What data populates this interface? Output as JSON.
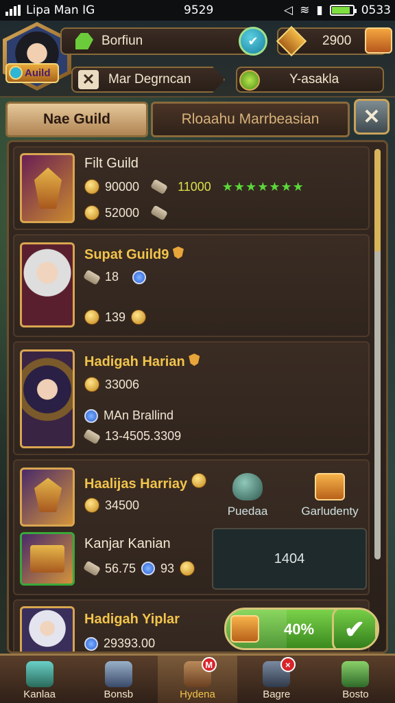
{
  "status_bar": {
    "carrier": "Lipa Man IG",
    "time": "9529",
    "clock": "0533",
    "battery_level": 0.85
  },
  "header": {
    "guild_tag": "Auild",
    "player_name": "Borfiun",
    "gold": "2900",
    "sub_label": "Mar Degrncan",
    "sub_label_right": "Y-asakla"
  },
  "tabs": [
    {
      "label": "Nae Guild",
      "active": true
    },
    {
      "label": "Rloaahu Marrbeasian",
      "active": false
    }
  ],
  "cards": [
    {
      "title": "Filt Guild",
      "row1_value": "90000",
      "row1_extra": "11000",
      "row1_stars": "★★★★★★★",
      "row2_value": "52000"
    },
    {
      "title": "Supat Guild9",
      "row1_value": "18",
      "row2_value": "139"
    },
    {
      "title": "Hadigah Harian",
      "row1_value": "33006",
      "row2_text": "MAn Brallind",
      "row3_text": "13-4505.3309"
    },
    {
      "title": "Haalijas Harriay",
      "row1_value": "34500",
      "reward1_label": "Puedaa",
      "reward2_label": "Garludenty",
      "sub_title": "Kanjar Kanian",
      "sub_value1": "56.75",
      "sub_value2": "93",
      "count_box": "1404"
    },
    {
      "title": "Hadigah Yiplar",
      "row1_value": "29393.00",
      "progress_label": "40%",
      "progress_value": 0.4
    }
  ],
  "bottom_nav": [
    {
      "label": "Kanlaa",
      "badge": ""
    },
    {
      "label": "Bonsb",
      "badge": ""
    },
    {
      "label": "Hydena",
      "badge": "M"
    },
    {
      "label": "Bagre",
      "badge": "×"
    },
    {
      "label": "Bosto",
      "badge": ""
    }
  ],
  "colors": {
    "accent_gold": "#f2c44c",
    "accent_green": "#5ad83a",
    "panel_border": "#6a4f30"
  }
}
